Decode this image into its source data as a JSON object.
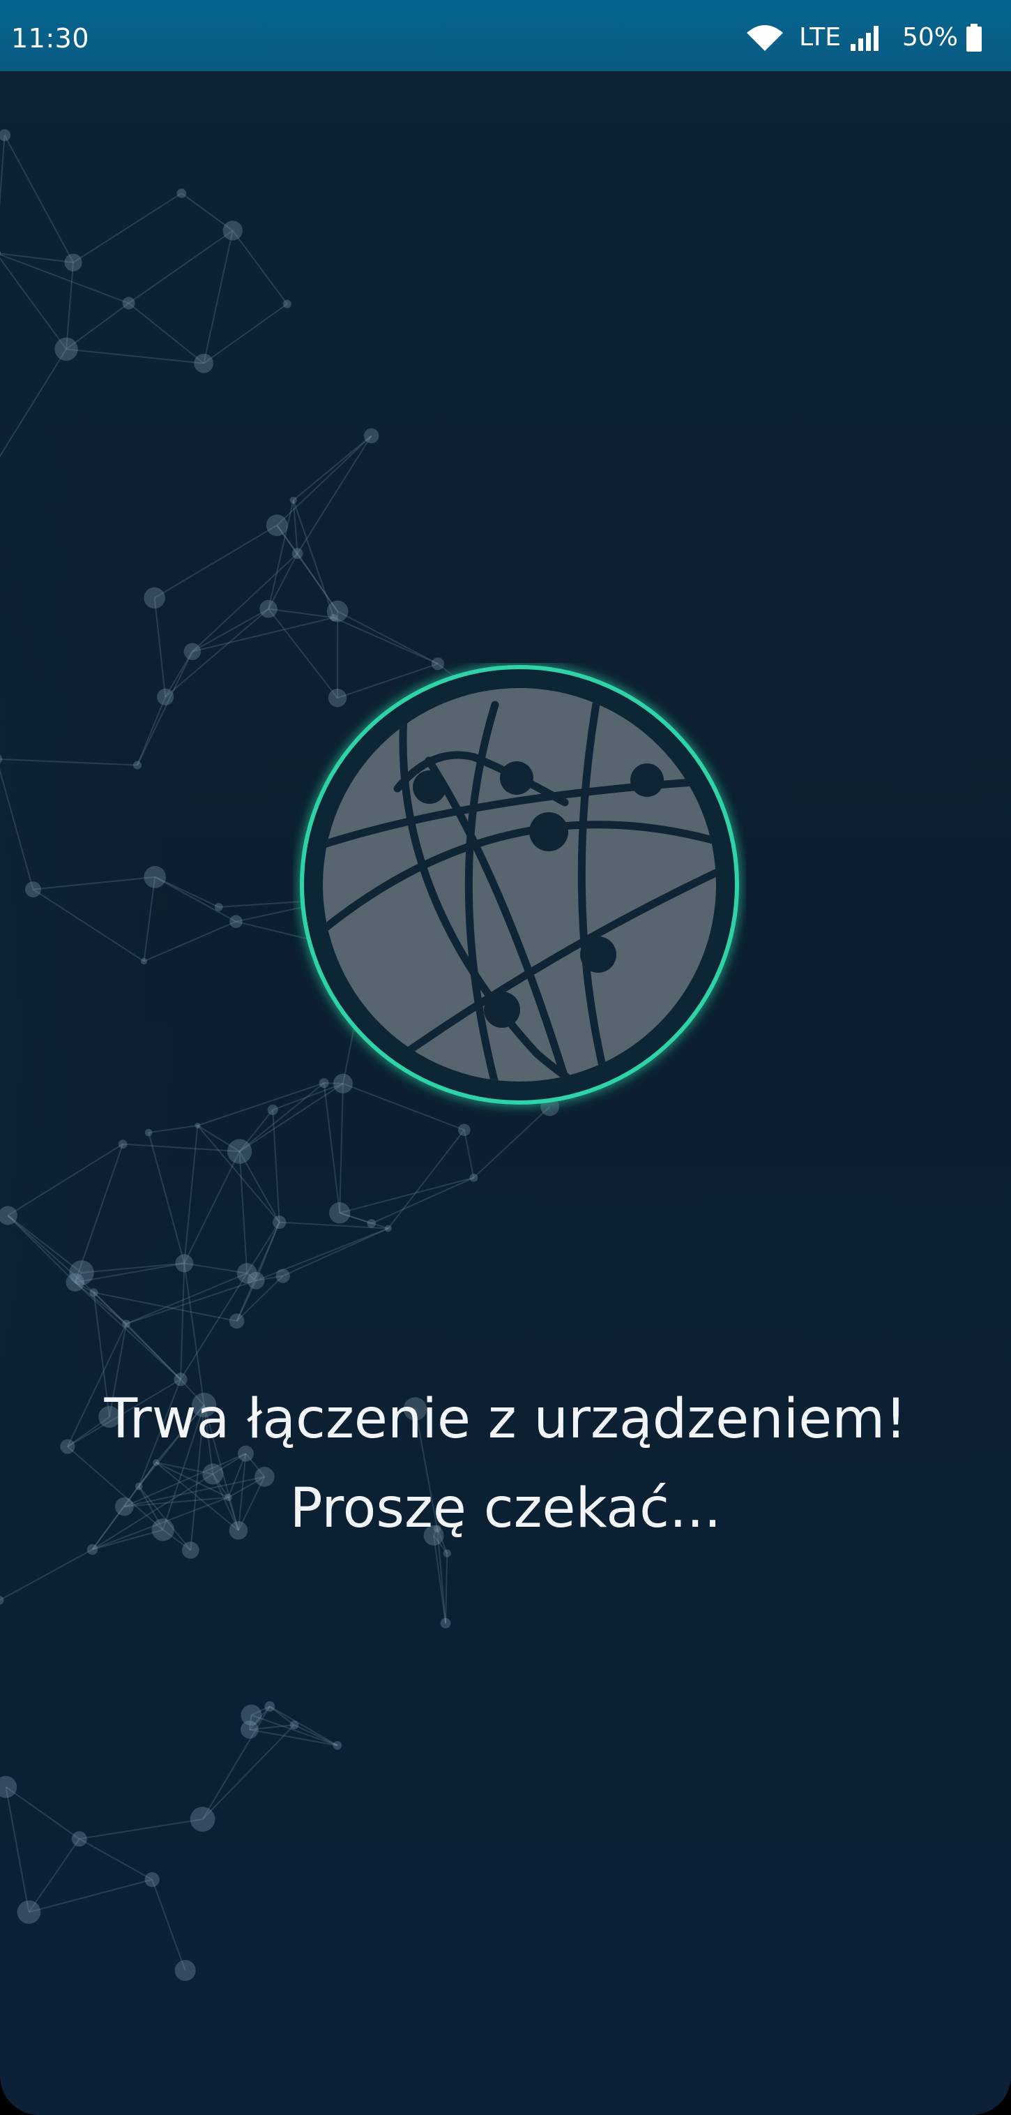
{
  "status_bar": {
    "time": "11:30",
    "network": "LTE",
    "battery": "50%",
    "icons": [
      "wifi-icon",
      "signal-icon",
      "battery-icon"
    ],
    "color": "#05658f"
  },
  "screen": {
    "background": "#0c2133",
    "accent_ring": "#2ed3a8",
    "globe_fill": "#57656f",
    "message_line_1": "Trwa łączenie z urządzeniem!",
    "message_line_2": "Proszę czekać..."
  }
}
